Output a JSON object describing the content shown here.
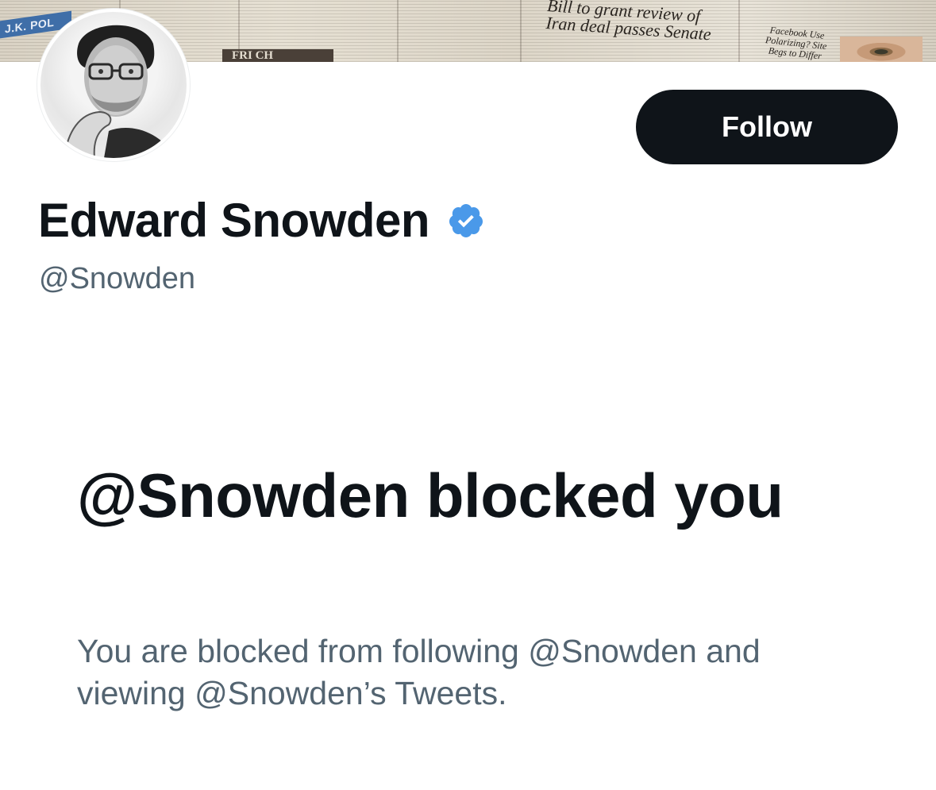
{
  "banner": {
    "tag_text": "J.K. POL",
    "dark_bar_text": "FRI CH",
    "headline_line1": "Bill to grant review of",
    "headline_line2": "Iran deal passes Senate",
    "side_headline": "Facebook Use Polarizing? Site Begs to Differ"
  },
  "profile": {
    "display_name": "Edward Snowden",
    "handle": "@Snowden",
    "verified": true,
    "verified_color": "#4a99e9"
  },
  "actions": {
    "follow_label": "Follow"
  },
  "blocked": {
    "title": "@Snowden blocked you",
    "description": "You are blocked from following @Snowden and viewing @Snowden’s Tweets."
  },
  "colors": {
    "text_primary": "#0f1419",
    "text_secondary": "#536471",
    "button_bg": "#0f1419",
    "button_text": "#ffffff"
  }
}
